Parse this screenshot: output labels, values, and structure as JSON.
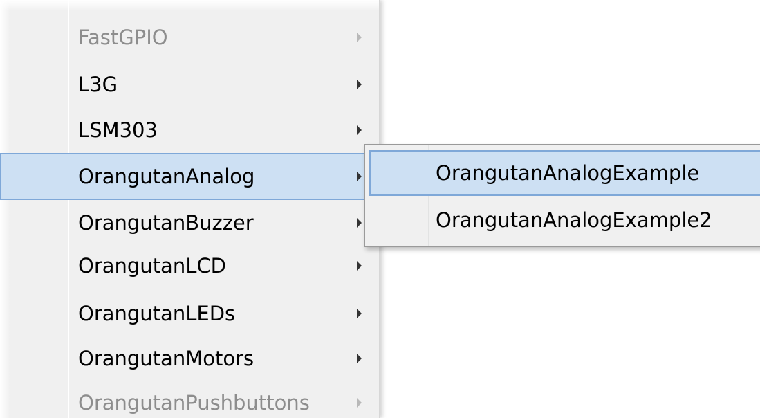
{
  "menu": {
    "items": [
      {
        "label": "FastGPIO",
        "enabled": false,
        "has_submenu": true
      },
      {
        "label": "L3G",
        "enabled": true,
        "has_submenu": true
      },
      {
        "label": "LSM303",
        "enabled": true,
        "has_submenu": true
      },
      {
        "label": "OrangutanAnalog",
        "enabled": true,
        "has_submenu": true,
        "highlighted": true
      },
      {
        "label": "OrangutanBuzzer",
        "enabled": true,
        "has_submenu": true
      },
      {
        "label": "OrangutanLCD",
        "enabled": true,
        "has_submenu": true
      },
      {
        "label": "OrangutanLEDs",
        "enabled": true,
        "has_submenu": true
      },
      {
        "label": "OrangutanMotors",
        "enabled": true,
        "has_submenu": true
      },
      {
        "label": "OrangutanPushbuttons",
        "enabled": false,
        "has_submenu": true
      }
    ]
  },
  "submenu": {
    "items": [
      {
        "label": "OrangutanAnalogExample",
        "highlighted": true
      },
      {
        "label": "OrangutanAnalogExample2"
      }
    ]
  },
  "colors": {
    "menu_bg": "#f0f0f0",
    "highlight_bg": "#cde0f3",
    "highlight_border": "#7fa8d8",
    "disabled_text": "#8d8d8d"
  }
}
